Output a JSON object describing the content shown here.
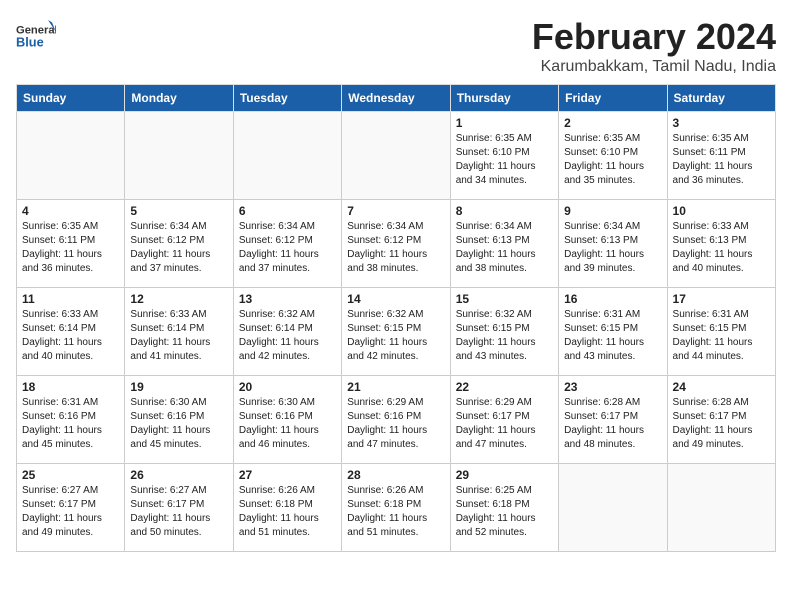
{
  "logo": {
    "general": "General",
    "blue": "Blue"
  },
  "title": "February 2024",
  "subtitle": "Karumbakkam, Tamil Nadu, India",
  "weekdays": [
    "Sunday",
    "Monday",
    "Tuesday",
    "Wednesday",
    "Thursday",
    "Friday",
    "Saturday"
  ],
  "weeks": [
    [
      {
        "day": "",
        "info": ""
      },
      {
        "day": "",
        "info": ""
      },
      {
        "day": "",
        "info": ""
      },
      {
        "day": "",
        "info": ""
      },
      {
        "day": "1",
        "info": "Sunrise: 6:35 AM\nSunset: 6:10 PM\nDaylight: 11 hours\nand 34 minutes."
      },
      {
        "day": "2",
        "info": "Sunrise: 6:35 AM\nSunset: 6:10 PM\nDaylight: 11 hours\nand 35 minutes."
      },
      {
        "day": "3",
        "info": "Sunrise: 6:35 AM\nSunset: 6:11 PM\nDaylight: 11 hours\nand 36 minutes."
      }
    ],
    [
      {
        "day": "4",
        "info": "Sunrise: 6:35 AM\nSunset: 6:11 PM\nDaylight: 11 hours\nand 36 minutes."
      },
      {
        "day": "5",
        "info": "Sunrise: 6:34 AM\nSunset: 6:12 PM\nDaylight: 11 hours\nand 37 minutes."
      },
      {
        "day": "6",
        "info": "Sunrise: 6:34 AM\nSunset: 6:12 PM\nDaylight: 11 hours\nand 37 minutes."
      },
      {
        "day": "7",
        "info": "Sunrise: 6:34 AM\nSunset: 6:12 PM\nDaylight: 11 hours\nand 38 minutes."
      },
      {
        "day": "8",
        "info": "Sunrise: 6:34 AM\nSunset: 6:13 PM\nDaylight: 11 hours\nand 38 minutes."
      },
      {
        "day": "9",
        "info": "Sunrise: 6:34 AM\nSunset: 6:13 PM\nDaylight: 11 hours\nand 39 minutes."
      },
      {
        "day": "10",
        "info": "Sunrise: 6:33 AM\nSunset: 6:13 PM\nDaylight: 11 hours\nand 40 minutes."
      }
    ],
    [
      {
        "day": "11",
        "info": "Sunrise: 6:33 AM\nSunset: 6:14 PM\nDaylight: 11 hours\nand 40 minutes."
      },
      {
        "day": "12",
        "info": "Sunrise: 6:33 AM\nSunset: 6:14 PM\nDaylight: 11 hours\nand 41 minutes."
      },
      {
        "day": "13",
        "info": "Sunrise: 6:32 AM\nSunset: 6:14 PM\nDaylight: 11 hours\nand 42 minutes."
      },
      {
        "day": "14",
        "info": "Sunrise: 6:32 AM\nSunset: 6:15 PM\nDaylight: 11 hours\nand 42 minutes."
      },
      {
        "day": "15",
        "info": "Sunrise: 6:32 AM\nSunset: 6:15 PM\nDaylight: 11 hours\nand 43 minutes."
      },
      {
        "day": "16",
        "info": "Sunrise: 6:31 AM\nSunset: 6:15 PM\nDaylight: 11 hours\nand 43 minutes."
      },
      {
        "day": "17",
        "info": "Sunrise: 6:31 AM\nSunset: 6:15 PM\nDaylight: 11 hours\nand 44 minutes."
      }
    ],
    [
      {
        "day": "18",
        "info": "Sunrise: 6:31 AM\nSunset: 6:16 PM\nDaylight: 11 hours\nand 45 minutes."
      },
      {
        "day": "19",
        "info": "Sunrise: 6:30 AM\nSunset: 6:16 PM\nDaylight: 11 hours\nand 45 minutes."
      },
      {
        "day": "20",
        "info": "Sunrise: 6:30 AM\nSunset: 6:16 PM\nDaylight: 11 hours\nand 46 minutes."
      },
      {
        "day": "21",
        "info": "Sunrise: 6:29 AM\nSunset: 6:16 PM\nDaylight: 11 hours\nand 47 minutes."
      },
      {
        "day": "22",
        "info": "Sunrise: 6:29 AM\nSunset: 6:17 PM\nDaylight: 11 hours\nand 47 minutes."
      },
      {
        "day": "23",
        "info": "Sunrise: 6:28 AM\nSunset: 6:17 PM\nDaylight: 11 hours\nand 48 minutes."
      },
      {
        "day": "24",
        "info": "Sunrise: 6:28 AM\nSunset: 6:17 PM\nDaylight: 11 hours\nand 49 minutes."
      }
    ],
    [
      {
        "day": "25",
        "info": "Sunrise: 6:27 AM\nSunset: 6:17 PM\nDaylight: 11 hours\nand 49 minutes."
      },
      {
        "day": "26",
        "info": "Sunrise: 6:27 AM\nSunset: 6:17 PM\nDaylight: 11 hours\nand 50 minutes."
      },
      {
        "day": "27",
        "info": "Sunrise: 6:26 AM\nSunset: 6:18 PM\nDaylight: 11 hours\nand 51 minutes."
      },
      {
        "day": "28",
        "info": "Sunrise: 6:26 AM\nSunset: 6:18 PM\nDaylight: 11 hours\nand 51 minutes."
      },
      {
        "day": "29",
        "info": "Sunrise: 6:25 AM\nSunset: 6:18 PM\nDaylight: 11 hours\nand 52 minutes."
      },
      {
        "day": "",
        "info": ""
      },
      {
        "day": "",
        "info": ""
      }
    ]
  ]
}
